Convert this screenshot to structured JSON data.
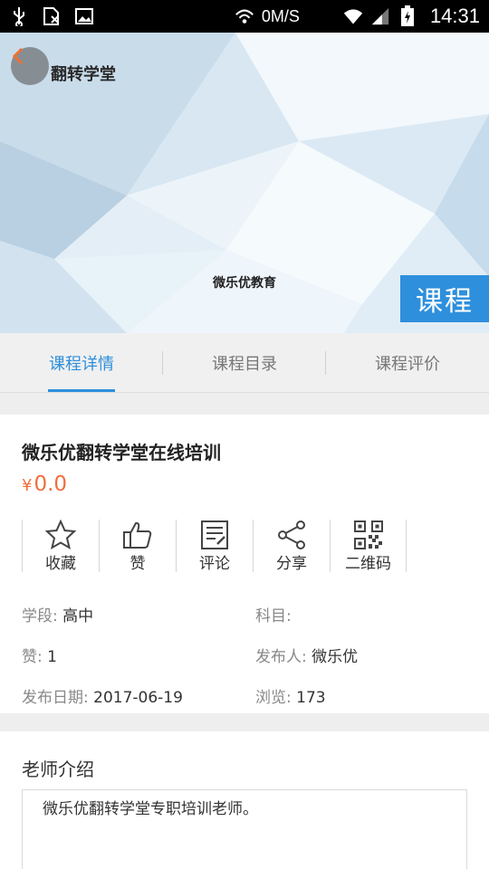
{
  "status_bar": {
    "net_speed": "0M/S",
    "time": "14:31",
    "icons": [
      "usb-icon",
      "sim-card-icon",
      "image-icon",
      "hotspot-icon",
      "wifi-icon",
      "signal-icon",
      "battery-icon"
    ]
  },
  "banner": {
    "brand": "翻转学堂",
    "caption": "微乐优教育",
    "tag": "课程"
  },
  "tabs": [
    {
      "label": "课程详情",
      "active": true
    },
    {
      "label": "课程目录",
      "active": false
    },
    {
      "label": "课程评价",
      "active": false
    }
  ],
  "course": {
    "title": "微乐优翻转学堂在线培训",
    "currency": "¥",
    "price": "0.0"
  },
  "actions": [
    {
      "label": "收藏",
      "icon": "star-icon"
    },
    {
      "label": "赞",
      "icon": "thumbs-up-icon"
    },
    {
      "label": "评论",
      "icon": "comment-icon"
    },
    {
      "label": "分享",
      "icon": "share-icon"
    },
    {
      "label": "二维码",
      "icon": "qr-code-icon"
    }
  ],
  "meta": {
    "stage_key": "学段:",
    "stage_val": "高中",
    "subject_key": "科目:",
    "subject_val": "",
    "likes_key": "赞:",
    "likes_val": "1",
    "publisher_key": "发布人:",
    "publisher_val": "微乐优",
    "date_key": "发布日期:",
    "date_val": "2017-06-19",
    "views_key": "浏览:",
    "views_val": "173"
  },
  "teacher": {
    "title": "老师介绍",
    "intro": "微乐优翻转学堂专职培训老师。"
  },
  "colors": {
    "accent": "#2e8fdc",
    "price": "#f06e3c"
  }
}
